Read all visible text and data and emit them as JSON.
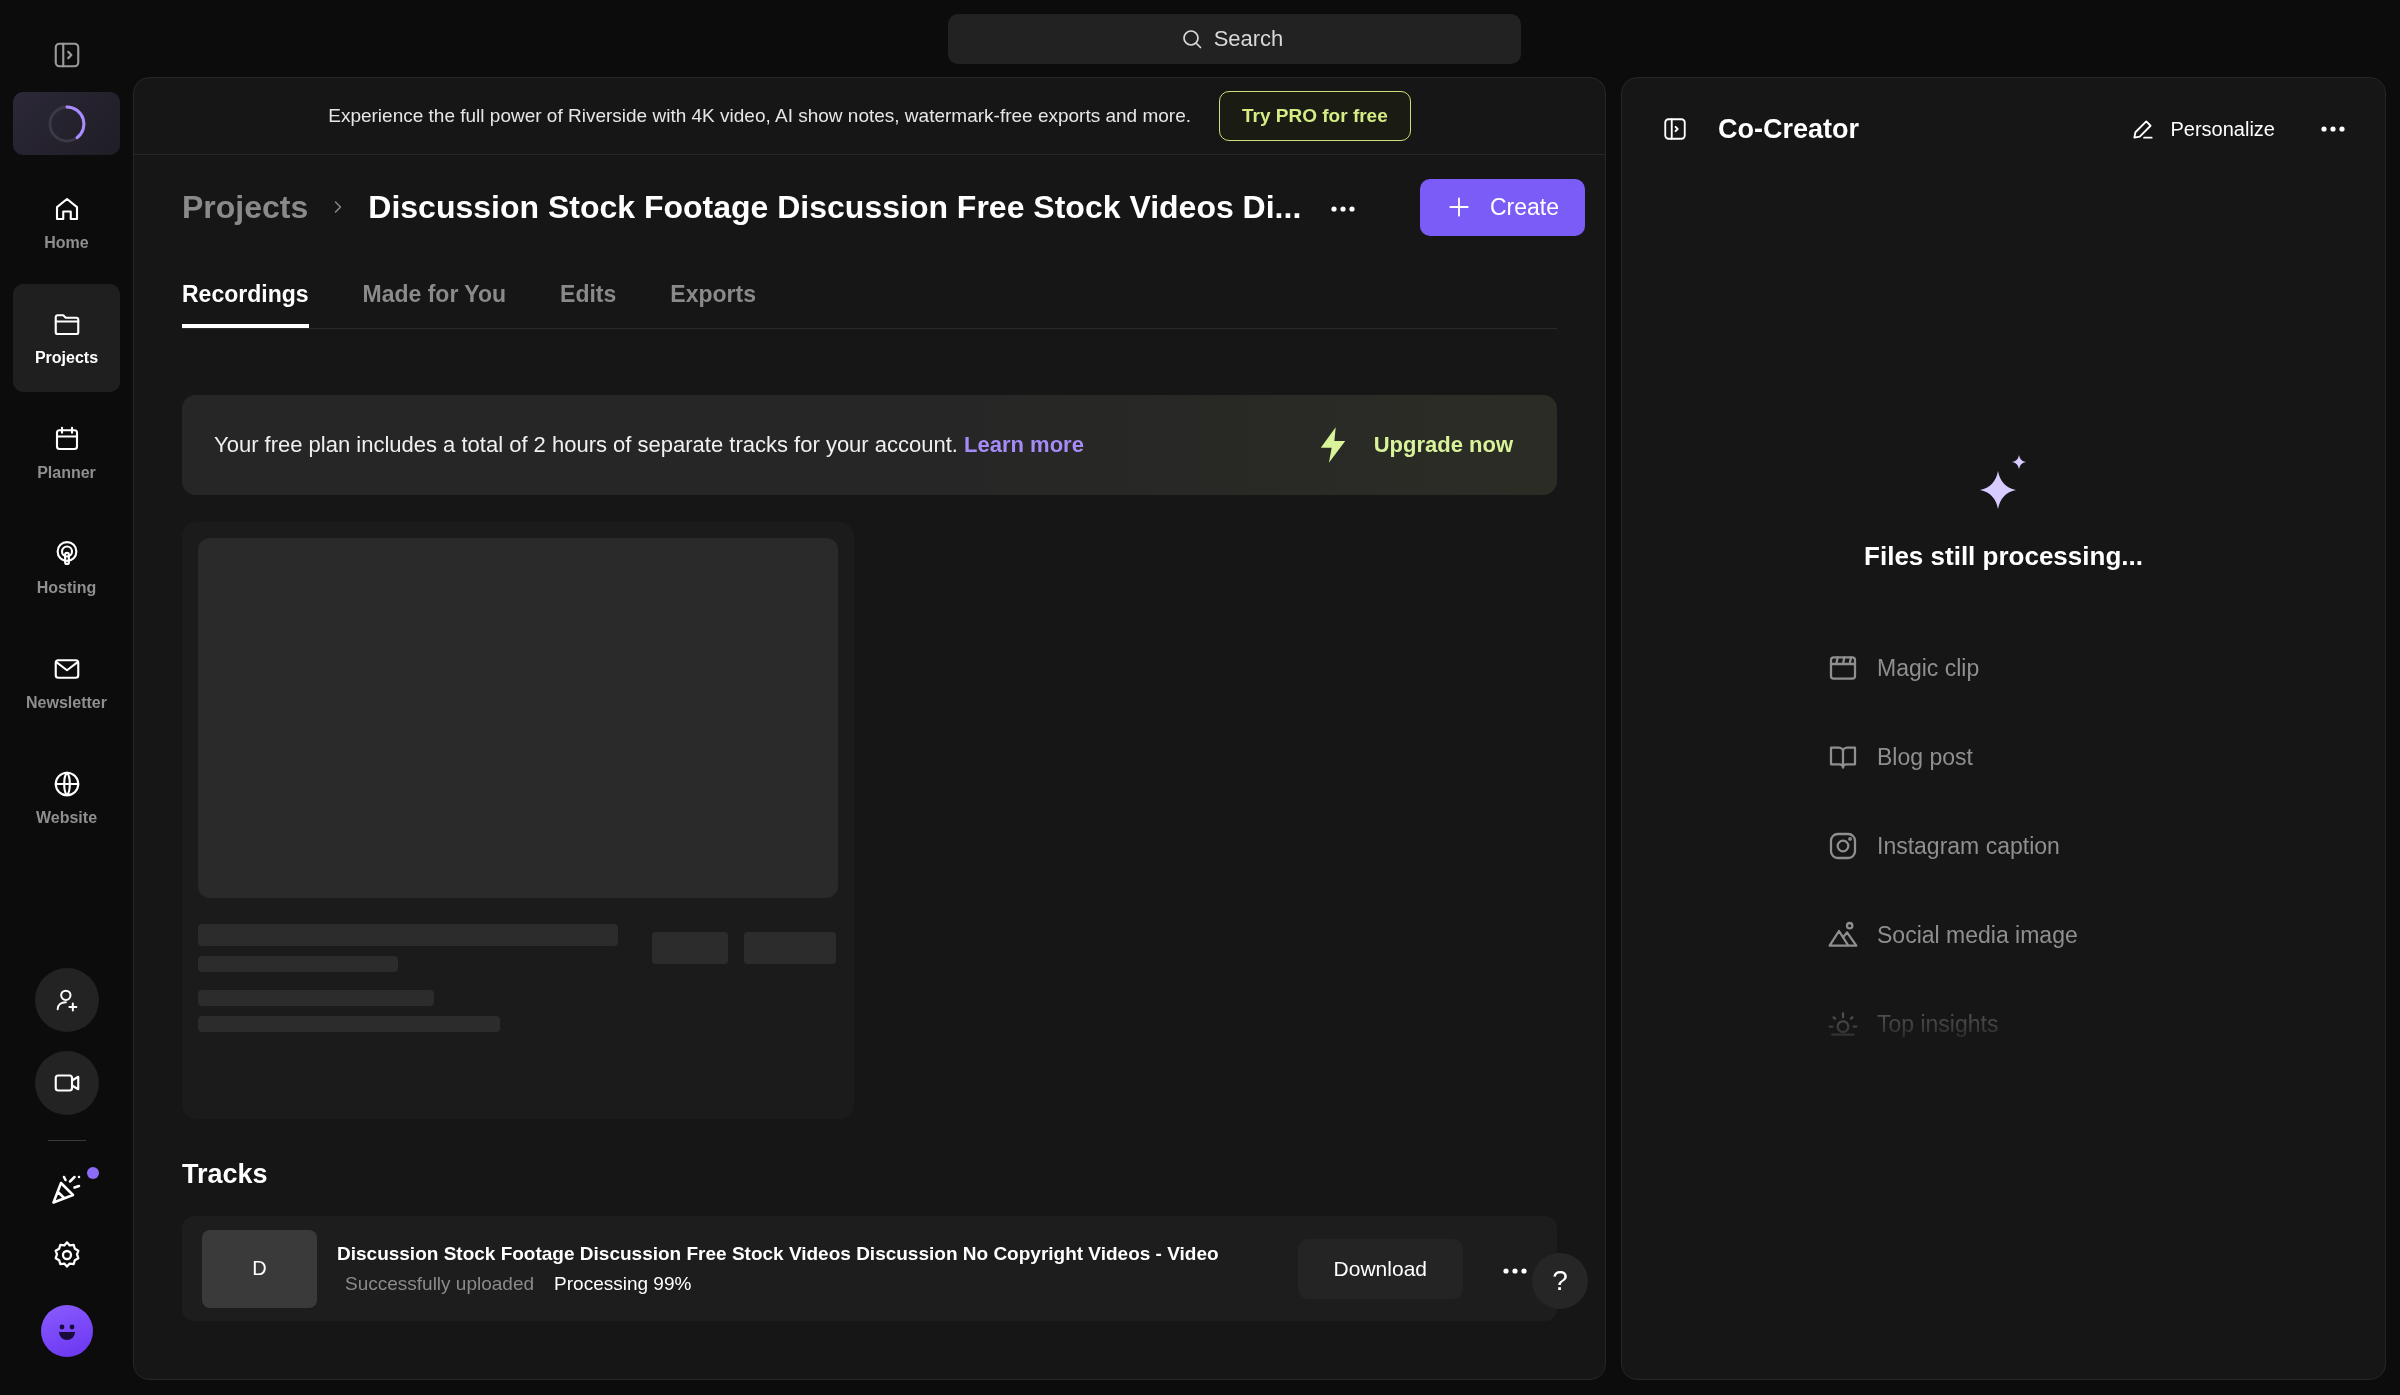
{
  "search": {
    "placeholder": "Search"
  },
  "sidebar": {
    "items": [
      {
        "label": "Home",
        "selected": false
      },
      {
        "label": "Projects",
        "selected": true
      },
      {
        "label": "Planner",
        "selected": false
      },
      {
        "label": "Hosting",
        "selected": false
      },
      {
        "label": "Newsletter",
        "selected": false
      },
      {
        "label": "Website",
        "selected": false
      }
    ],
    "whats_new": {
      "unread": true
    }
  },
  "promo_banner": {
    "text": "Experience the full power of Riverside with 4K video, AI show notes, watermark-free exports and more.",
    "button": "Try PRO for free"
  },
  "breadcrumb": {
    "parent": "Projects",
    "title": "Discussion Stock Footage Discussion Free Stock Videos Di..."
  },
  "create_button": "Create",
  "tabs": [
    {
      "label": "Recordings",
      "selected": true
    },
    {
      "label": "Made for You",
      "selected": false
    },
    {
      "label": "Edits",
      "selected": false
    },
    {
      "label": "Exports",
      "selected": false
    }
  ],
  "plan_notice": {
    "text": "Your free plan includes a total of 2 hours of separate tracks for your account.",
    "link": "Learn more",
    "action": "Upgrade now"
  },
  "tracks": {
    "heading": "Tracks",
    "items": [
      {
        "initial": "D",
        "title": "Discussion Stock Footage Discussion Free Stock Videos Discussion No Copyright Videos - Video",
        "status": "Successfully uploaded",
        "progress": "Processing 99%",
        "button": "Download"
      }
    ]
  },
  "help_button": "?",
  "co_creator": {
    "title": "Co-Creator",
    "personalize": "Personalize",
    "status": "Files still processing...",
    "items": [
      "Magic clip",
      "Blog post",
      "Instagram caption",
      "Social media image",
      "Top insights"
    ]
  }
}
